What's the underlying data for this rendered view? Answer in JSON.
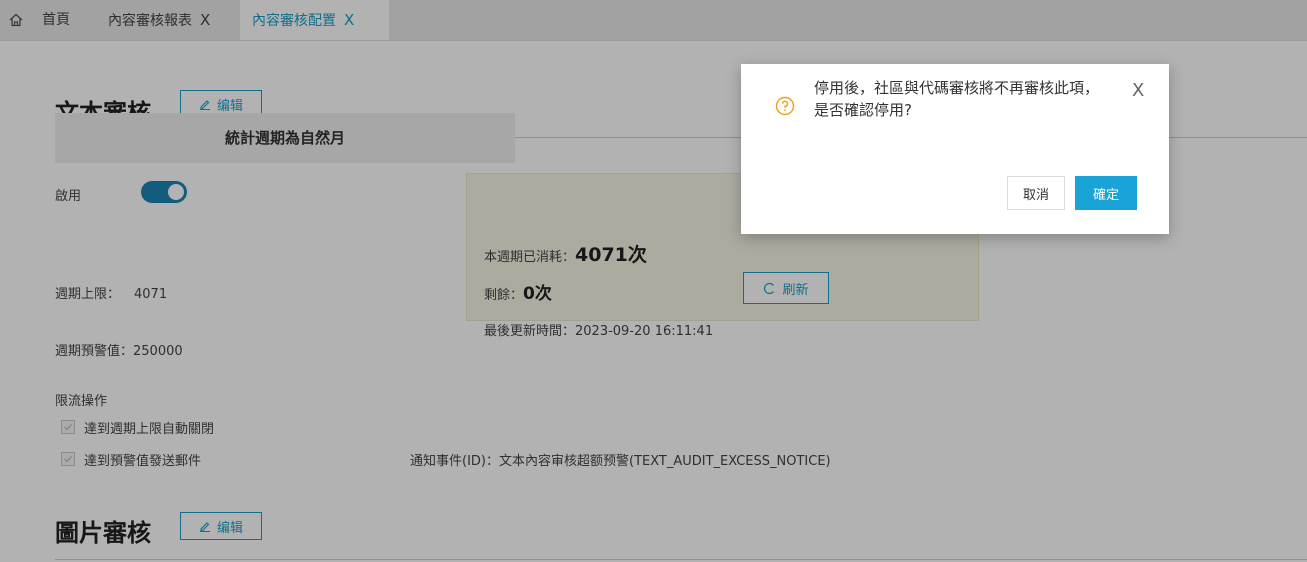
{
  "tabs": [
    {
      "label": "首頁"
    },
    {
      "label": "內容審核報表",
      "close": "X"
    },
    {
      "label": "內容審核配置",
      "close": "X"
    }
  ],
  "text_audit": {
    "title": "文本審核",
    "edit_label": "编辑",
    "period_label": "統計週期為自然月",
    "enabled_label": "啟用",
    "enabled": true,
    "limit_label": "週期上限：",
    "limit_value": "4071",
    "warning_label": "週期預警值：",
    "warning_value": "250000",
    "usage": {
      "consumed_label": "本週期已消耗：",
      "consumed_value": "4071次",
      "remaining_label": "剩餘：",
      "remaining_value": "0次",
      "updated_label": "最後更新時間：",
      "updated_value": "2023-09-20 16:11:41",
      "refresh_label": "刷新"
    },
    "throttle_title": "限流操作",
    "throttle_options": [
      {
        "label": "達到週期上限自動關閉",
        "checked": true
      },
      {
        "label": "達到預警值發送郵件",
        "checked": true
      }
    ],
    "notice_label": "通知事件(ID)：",
    "notice_value": "文本內容审核超额预警(TEXT_AUDIT_EXCESS_NOTICE)"
  },
  "image_audit": {
    "title": "圖片審核",
    "edit_label": "编辑"
  },
  "dialog": {
    "message_line1": "停用後，社區與代碼審核將不再審核此項，",
    "message_line2": "是否確認停用?",
    "close": "X",
    "cancel_label": "取消",
    "ok_label": "確定"
  },
  "colors": {
    "accent": "#1a9ec9",
    "toggle": "#1a86b3",
    "warning_icon": "#f0a020",
    "usage_bg": "#f7f5e6"
  }
}
